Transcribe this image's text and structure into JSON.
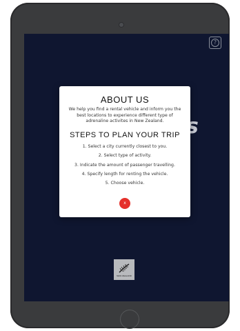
{
  "help": {
    "icon": "question-icon",
    "glyph": "?"
  },
  "background": {
    "logo_partial": "s"
  },
  "about": {
    "title": "ABOUT US",
    "text": "We help you find a rental vehicle and inform you the best locations to experience different type of adrenaline activites in New Zealand."
  },
  "steps": {
    "title": "STEPS TO PLAN YOUR TRIP",
    "items": [
      "1. Select a city currently closest to you.",
      "2. Select type of activity.",
      "3. Indicate the amount of passenger travelling.",
      "4. Specify length for renting the vehicle.",
      "5. Choose vehicle."
    ]
  },
  "close_button": {
    "label": "x"
  },
  "nz_logo": {
    "caption": "NEW ZEALAND"
  },
  "colors": {
    "screen_bg": "#0f1630",
    "close": "#e5302b"
  }
}
